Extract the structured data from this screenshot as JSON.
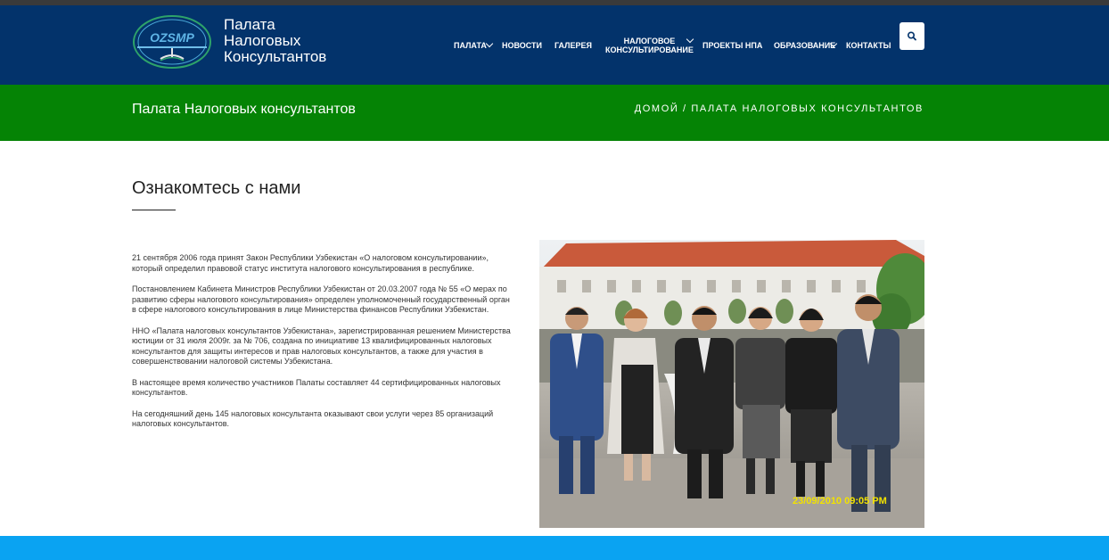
{
  "header": {
    "brand_lines": [
      "Палата",
      "Налоговых",
      "Консультантов"
    ],
    "logo_text": "OZSMP",
    "nav": [
      {
        "label": "ПАЛАТА",
        "dropdown": true
      },
      {
        "label": "НОВОСТИ",
        "dropdown": false
      },
      {
        "label": "ГАЛЕРЕЯ",
        "dropdown": false
      },
      {
        "label_line1": "НАЛОГОВОЕ",
        "label_line2": "КОНСУЛЬТИРОВАНИЕ",
        "dropdown": true
      },
      {
        "label": "ПРОЕКТЫ НПА",
        "dropdown": false
      },
      {
        "label": "ОБРАЗОВАНИЕ",
        "dropdown": true
      },
      {
        "label": "КОНТАКТЫ",
        "dropdown": false
      }
    ],
    "search_icon": "search-icon"
  },
  "banner": {
    "title": "Палата Налоговых консультантов",
    "breadcrumb_home": "ДОМОЙ",
    "breadcrumb_sep": "/",
    "breadcrumb_current": "ПАЛАТА НАЛОГОВЫХ КОНСУЛЬТАНТОВ"
  },
  "main": {
    "section_title": "Ознакомтесь с нами",
    "paragraphs": [
      "21 сентября 2006 года принят Закон Республики Узбекистан «О налоговом консультировании», который определил правовой статус института налогового консультирования в республике.",
      "Постановлением Кабинета Министров Республики Узбекистан от 20.03.2007 года № 55 «О мерах по развитию сферы налогового консультирования» определен уполномоченный государственный орган в сфере налогового консультирования в лице Министерства финансов Республики Узбекистан.",
      "ННО «Палата налоговых консультантов Узбекистана», зарегистрированная решением Министерства юстиции от 31 июля 2009г. за № 706, создана по инициативе 13 квалифицированных налоговых консультантов для защиты интересов и прав налоговых консультантов, а также для участия в совершенствовании налоговой системы Узбекистана.",
      "В настоящее время количество участников Палаты составляет 44 сертифицированных налоговых консультантов.",
      "На сегодняшний день 145 налоговых консультанта оказывают свои услуги через 85 организаций налоговых консультантов."
    ],
    "photo_timestamp": "23/09/2010 09:05 PM"
  },
  "colors": {
    "header_bg": "#03336b",
    "banner_bg": "#058305",
    "footer_bg": "#0aa3f2"
  }
}
